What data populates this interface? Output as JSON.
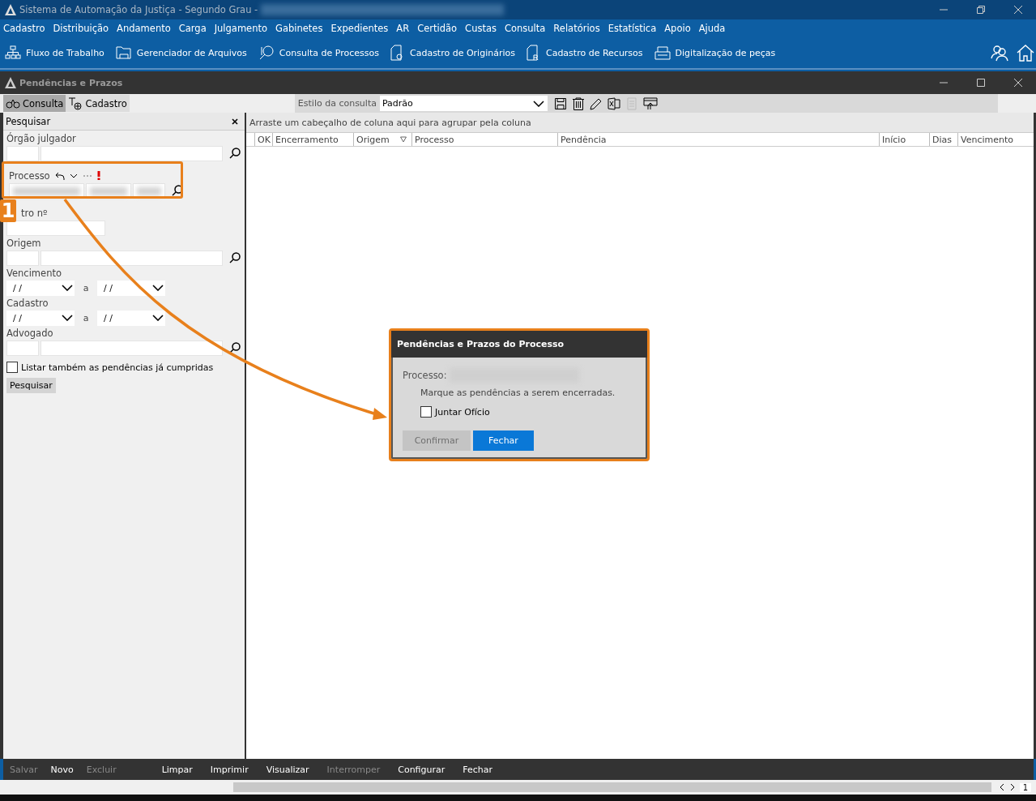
{
  "window": {
    "title": "Sistema de Automação da Justiça - Segundo Grau -"
  },
  "menu": [
    "Cadastro",
    "Distribuição",
    "Andamento",
    "Carga",
    "Julgamento",
    "Gabinetes",
    "Expedientes",
    "AR",
    "Certidão",
    "Custas",
    "Consulta",
    "Relatórios",
    "Estatística",
    "Apoio",
    "Ajuda"
  ],
  "toolbar": [
    "Fluxo de Trabalho",
    "Gerenciador de Arquivos",
    "Consulta de Processos",
    "Cadastro de Originários",
    "Cadastro de Recursos",
    "Digitalização de peças"
  ],
  "panel": {
    "title": "Pendências e Prazos"
  },
  "tabs": [
    {
      "label": "Consulta",
      "selected": true
    },
    {
      "label": "Cadastro",
      "selected": false
    }
  ],
  "query_style": {
    "label": "Estilo da consulta",
    "value": "Padrão"
  },
  "search": {
    "title": "Pesquisar",
    "fields": [
      {
        "kind": "lookup",
        "label": "Órgão julgador"
      },
      {
        "kind": "processo",
        "label": "Processo"
      },
      {
        "kind": "text",
        "label": "tro nº"
      },
      {
        "kind": "lookup",
        "label": "Origem"
      },
      {
        "kind": "daterange",
        "label": "Vencimento",
        "from": "/ /",
        "separator": "a",
        "to": "/ /"
      },
      {
        "kind": "daterange",
        "label": "Cadastro",
        "from": "/ /",
        "separator": "a",
        "to": "/ /"
      },
      {
        "kind": "lookup",
        "label": "Advogado"
      }
    ],
    "checkbox": {
      "label": "Listar também as pendências já cumpridas",
      "checked": false
    },
    "button": "Pesquisar"
  },
  "grid": {
    "group_hint": "Arraste um cabeçalho de coluna aqui para agrupar pela coluna",
    "columns": [
      "OK",
      "Encerramento",
      "Origem",
      "Processo",
      "Pendência",
      "Início",
      "Dias",
      "Vencimento"
    ]
  },
  "dialog": {
    "title": "Pendências e Prazos do Processo",
    "processo_label": "Processo:",
    "message": "Marque as pendências a serem encerradas.",
    "checkbox": {
      "label": "Juntar Ofício",
      "checked": false
    },
    "buttons": [
      {
        "label": "Confirmar",
        "disabled": true,
        "primary": false
      },
      {
        "label": "Fechar",
        "disabled": false,
        "primary": true
      }
    ]
  },
  "actions": [
    {
      "label": "Salvar",
      "disabled": true
    },
    {
      "label": "Novo",
      "disabled": false
    },
    {
      "label": "Excluir",
      "disabled": true
    },
    {
      "label": "Limpar",
      "disabled": false
    },
    {
      "label": "Imprimir",
      "disabled": false
    },
    {
      "label": "Visualizar",
      "disabled": false
    },
    {
      "label": "Interromper",
      "disabled": true
    },
    {
      "label": "Configurar",
      "disabled": false
    },
    {
      "label": "Fechar",
      "disabled": false
    }
  ],
  "pager": {
    "page": "1"
  },
  "callout": {
    "number": "1"
  }
}
